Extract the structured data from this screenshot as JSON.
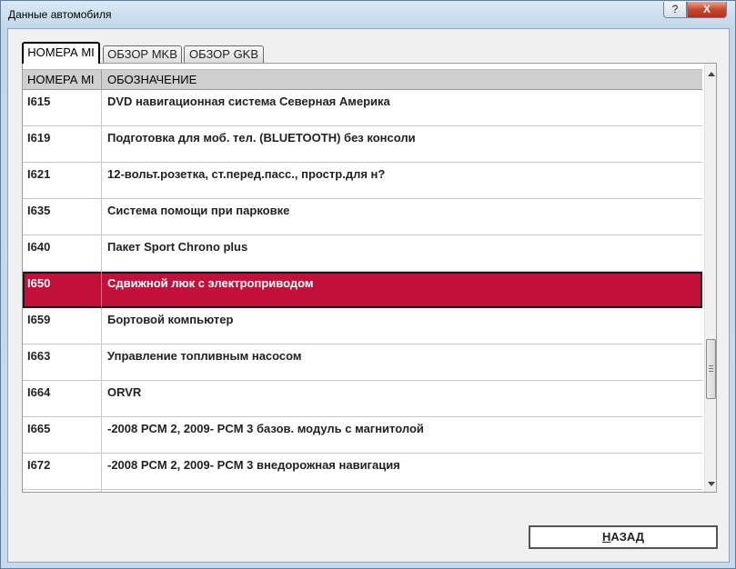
{
  "window": {
    "title": "Данные автомобиля",
    "help_label": "?",
    "close_label": "X"
  },
  "tabs": [
    {
      "label": "НОМЕРА MI",
      "active": true
    },
    {
      "label": "ОБЗОР MKB",
      "active": false
    },
    {
      "label": "ОБЗОР GKB",
      "active": false
    }
  ],
  "table": {
    "headers": [
      "НОМЕРА MI",
      "ОБОЗНАЧЕНИЕ"
    ],
    "rows": [
      {
        "code": "I615",
        "desc": "DVD навигационная система Северная Америка"
      },
      {
        "code": "I619",
        "desc": "Подготовка для моб. тел. (BLUETOOTH) без консоли"
      },
      {
        "code": "I621",
        "desc": "12-вольт.розетка, ст.перед.пасс., простр.для н?"
      },
      {
        "code": "I635",
        "desc": "Система помощи при парковке"
      },
      {
        "code": "I640",
        "desc": "Пакет Sport Chrono plus"
      },
      {
        "code": "I650",
        "desc": "Сдвижной люк с электроприводом",
        "selected": true
      },
      {
        "code": "I659",
        "desc": "Бортовой компьютер"
      },
      {
        "code": "I663",
        "desc": "Управление топливным насосом"
      },
      {
        "code": "I664",
        "desc": "ORVR"
      },
      {
        "code": "I665",
        "desc": "-2008 PCM 2, 2009- PCM 3 базов. модуль с магнитолой"
      },
      {
        "code": "I672",
        "desc": "-2008 PCM 2, 2009- PCM 3 внедорожная навигация"
      },
      {
        "code": "",
        "desc": ""
      }
    ]
  },
  "back_button": {
    "mnemonic": "Н",
    "rest": "АЗАД"
  },
  "colors": {
    "selected_row": "#c2103c",
    "header_bg": "#cfcfcf"
  }
}
